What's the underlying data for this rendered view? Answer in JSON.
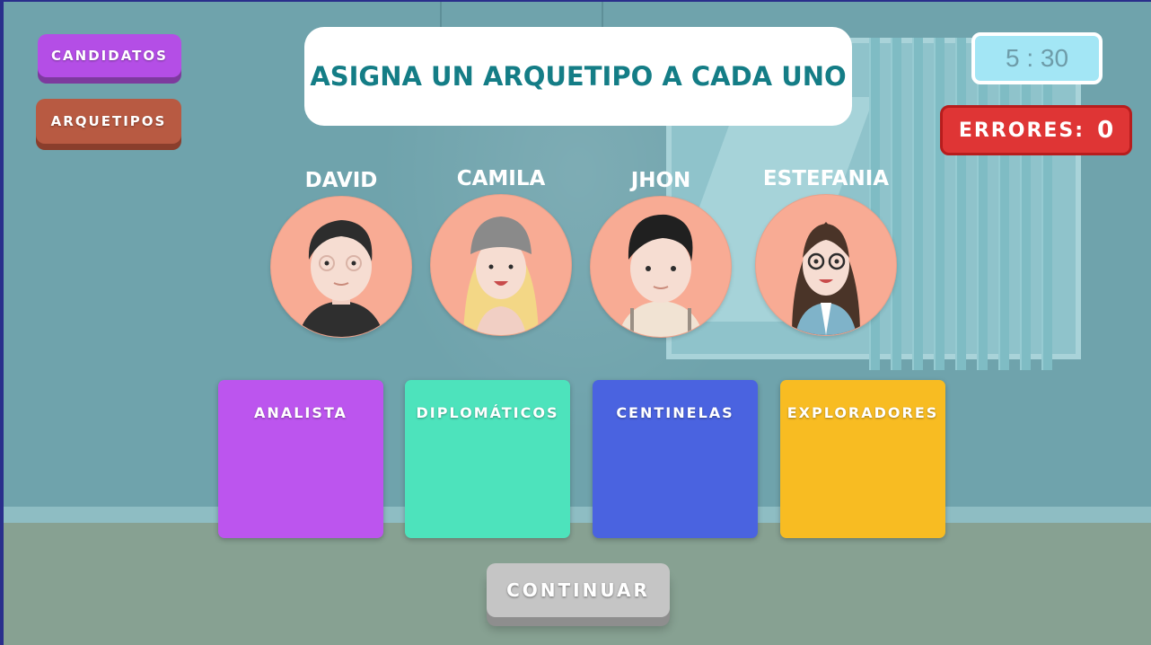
{
  "sidebar": {
    "candidates_label": "CANDIDATOS",
    "archetypes_label": "ARQUETIPOS"
  },
  "header": {
    "instruction": "ASIGNA UN ARQUETIPO A CADA UNO"
  },
  "hud": {
    "timer": "5 : 30",
    "errors_label": "ERRORES:",
    "errors_count": "0"
  },
  "candidates": [
    {
      "name": "DAVID",
      "avatar": "boy-dark-curly-hair-glasses-icon"
    },
    {
      "name": "CAMILA",
      "avatar": "girl-blonde-beanie-icon"
    },
    {
      "name": "JHON",
      "avatar": "boy-black-hair-icon"
    },
    {
      "name": "ESTEFANIA",
      "avatar": "girl-brown-hair-glasses-icon"
    }
  ],
  "archetypes": [
    {
      "label": "ANALISTA",
      "color": "#bc55ee"
    },
    {
      "label": "DIPLOMÁTICOS",
      "color": "#4de3bc"
    },
    {
      "label": "CENTINELAS",
      "color": "#4a63e0"
    },
    {
      "label": "EXPLORADORES",
      "color": "#f8bc22"
    }
  ],
  "footer": {
    "continue_label": "CONTINUAR"
  },
  "colors": {
    "title_text": "#147d86",
    "avatar_bg": "#f8ab94",
    "errors_bg": "#df3535",
    "timer_bg": "#a3e6f5"
  }
}
